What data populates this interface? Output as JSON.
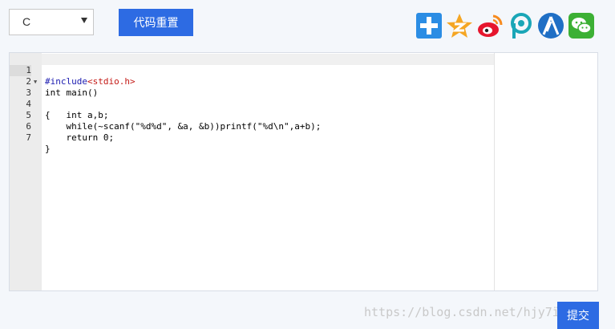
{
  "toolbar": {
    "language_value": "C",
    "reset_label": "代码重置"
  },
  "share_icons": [
    "plus-share-icon",
    "qzone-star-icon",
    "weibo-icon",
    "p-share-icon",
    "renren-icon",
    "wechat-icon"
  ],
  "editor": {
    "line_numbers": [
      "1",
      "2",
      "3",
      "4",
      "5",
      "6",
      "7"
    ],
    "lines": [
      "#include<stdio.h>",
      "int main()",
      "{",
      "    int a,b;",
      "    while(~scanf(\"%d%d\", &a, &b))printf(\"%d\\n\",a+b);",
      "    return 0;",
      "}"
    ]
  },
  "watermark": "https://blog.csdn.net/hjy7ï68",
  "submit_label": "提交",
  "colors": {
    "accent": "#2d6be3",
    "background": "#f4f7fb"
  }
}
